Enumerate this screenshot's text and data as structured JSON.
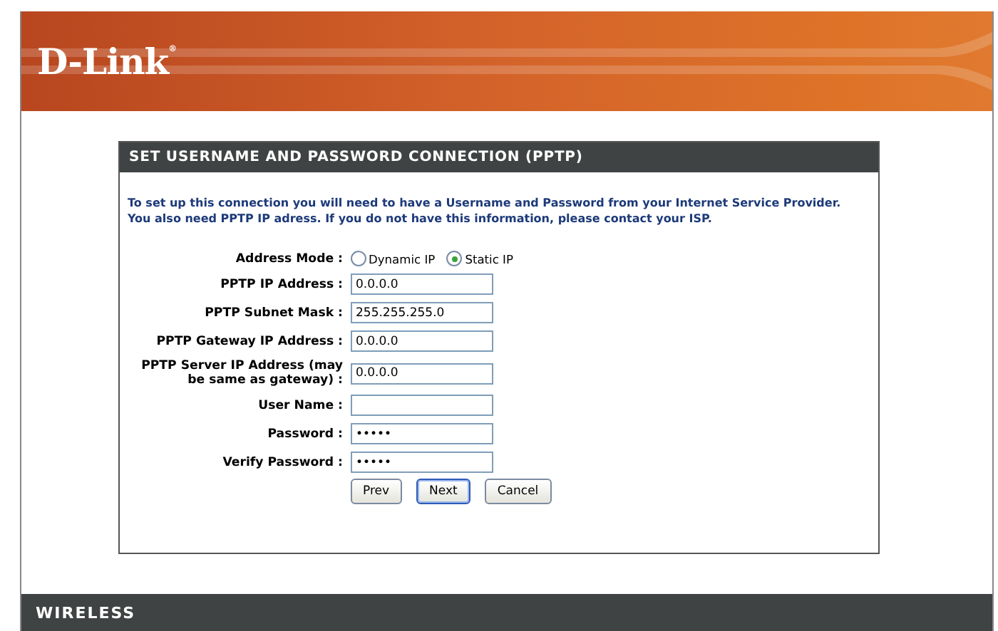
{
  "header": {
    "logo": "D-Link",
    "logo_mark": "®"
  },
  "panel": {
    "title": "SET USERNAME AND PASSWORD CONNECTION (PPTP)",
    "intro": [
      "To set up this connection you will need to have a Username and Password from your Internet Service Provider.",
      "You also need PPTP IP adress. If you do not have this information, please contact your ISP."
    ],
    "address_mode": {
      "label": "Address Mode :",
      "options": [
        {
          "label": "Dynamic IP",
          "selected": false
        },
        {
          "label": "Static IP",
          "selected": true
        }
      ]
    },
    "fields": [
      {
        "label": "PPTP IP Address :",
        "value": "0.0.0.0"
      },
      {
        "label": "PPTP Subnet Mask :",
        "value": "255.255.255.0"
      },
      {
        "label": "PPTP Gateway IP Address :",
        "value": "0.0.0.0"
      },
      {
        "label": "PPTP Server IP Address (may be same as gateway) :",
        "value": "0.0.0.0"
      },
      {
        "label": "User Name :"
      },
      {
        "label": "Password :",
        "value": "•••••"
      },
      {
        "label": "Verify Password :",
        "value": "•••••"
      }
    ],
    "buttons": [
      {
        "label": "Prev",
        "focused": false
      },
      {
        "label": "Next",
        "focused": true
      },
      {
        "label": "Cancel",
        "focused": false
      }
    ]
  },
  "footer": {
    "label": "WIRELESS"
  }
}
